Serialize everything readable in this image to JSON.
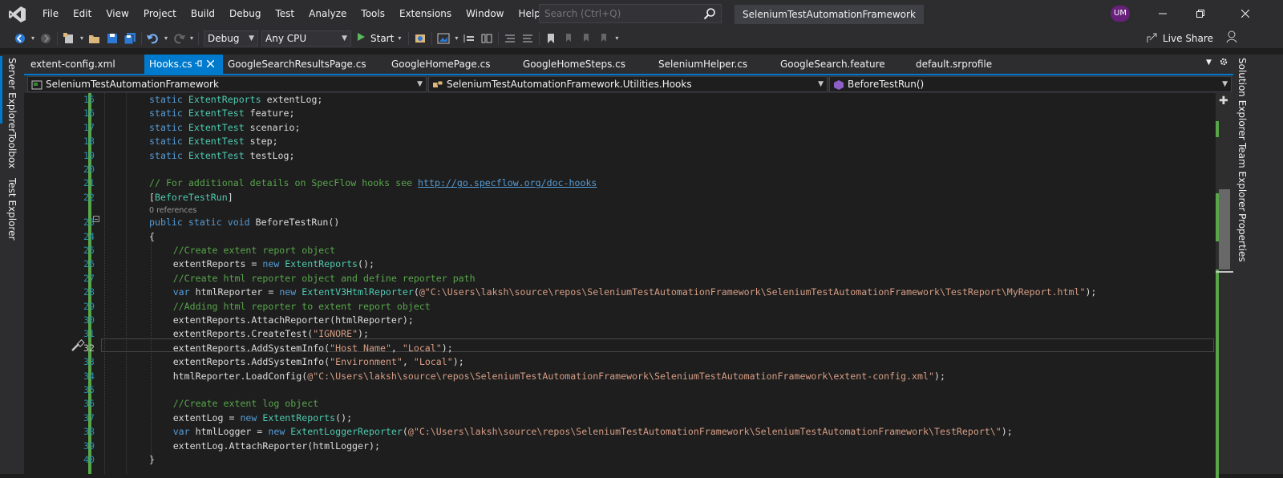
{
  "menu": {
    "items": [
      "File",
      "Edit",
      "View",
      "Project",
      "Build",
      "Debug",
      "Test",
      "Analyze",
      "Tools",
      "Extensions",
      "Window",
      "Help"
    ],
    "search_placeholder": "Search (Ctrl+Q)",
    "solution_title": "SeleniumTestAutomationFramework",
    "avatar": "UM"
  },
  "toolbar": {
    "config": "Debug",
    "platform": "Any CPU",
    "start_label": "Start",
    "live_share": "Live Share"
  },
  "left_dock": [
    "Server Explorer",
    "Toolbox",
    "Test Explorer"
  ],
  "right_dock": [
    "Solution Explorer",
    "Team Explorer",
    "Properties"
  ],
  "tabs": [
    {
      "label": "extent-config.xml"
    },
    {
      "label": "Hooks.cs"
    },
    {
      "label": "GoogleSearchResultsPage.cs"
    },
    {
      "label": "GoogleHomePage.cs"
    },
    {
      "label": "GoogleHomeSteps.cs"
    },
    {
      "label": "SeleniumHelper.cs"
    },
    {
      "label": "GoogleSearch.feature"
    },
    {
      "label": "default.srprofile"
    }
  ],
  "navbar": {
    "project": "SeleniumTestAutomationFramework",
    "type": "SeleniumTestAutomationFramework.Utilities.Hooks",
    "member": "BeforeTestRun()"
  },
  "editor": {
    "references": "0 references",
    "line_numbers": [
      "15",
      "16",
      "17",
      "18",
      "19",
      "20",
      "21",
      "22",
      "23",
      "24",
      "25",
      "26",
      "27",
      "28",
      "29",
      "30",
      "31",
      "32",
      "33",
      "34",
      "35",
      "36",
      "37",
      "38",
      "39",
      "40"
    ],
    "code": {
      "l15": "static ExtentReports extentLog;",
      "l16": "static ExtentTest feature;",
      "l17": "static ExtentTest scenario;",
      "l18": "static ExtentTest step;",
      "l19": "static ExtentTest testLog;",
      "l21_comment": "// For additional details on SpecFlow hooks see ",
      "l21_link": "http://go.specflow.org/doc-hooks",
      "l22": "[BeforeTestRun]",
      "l23": "public static void BeforeTestRun()",
      "l24": "{",
      "l25": "//Create extent report object",
      "l26": "extentReports = new ExtentReports();",
      "l27": "//Create html reporter object and define reporter path",
      "l28_a": "var htmlReporter = new ExtentV3HtmlReporter(",
      "l28_s": "@\"C:\\Users\\laksh\\source\\repos\\SeleniumTestAutomationFramework\\SeleniumTestAutomationFramework\\TestReport\\MyReport.html\"",
      "l28_b": ");",
      "l29": "//Adding html reporter to extent report object",
      "l30": "extentReports.AttachReporter(htmlReporter);",
      "l31_a": "extentReports.CreateTest(",
      "l31_s": "\"IGNORE\"",
      "l31_b": ");",
      "l32_a": "extentReports.AddSystemInfo(",
      "l32_s1": "\"Host Name\"",
      "l32_sep": ", ",
      "l32_s2": "\"Local\"",
      "l32_b": ");",
      "l33_a": "extentReports.AddSystemInfo(",
      "l33_s1": "\"Environment\"",
      "l33_sep": ", ",
      "l33_s2": "\"Local\"",
      "l33_b": ");",
      "l34_a": "htmlReporter.LoadConfig(",
      "l34_s": "@\"C:\\Users\\laksh\\source\\repos\\SeleniumTestAutomationFramework\\SeleniumTestAutomationFramework\\extent-config.xml\"",
      "l34_b": ");",
      "l36": "//Create extent log object",
      "l37": "extentLog = new ExtentReports();",
      "l38_a": "var htmlLogger = new ExtentLoggerReporter(",
      "l38_s": "@\"C:\\Users\\laksh\\source\\repos\\SeleniumTestAutomationFramework\\SeleniumTestAutomationFramework\\TestReport\\\"",
      "l38_b": ");",
      "l39": "extentLog.AttachReporter(htmlLogger);",
      "l40": "}"
    }
  },
  "colors": {
    "accent": "#007acc",
    "keyword": "#569cd6",
    "type": "#4ec9b0",
    "string": "#d69d85",
    "comment": "#57a64a",
    "line_number": "#2b91af"
  },
  "icons": [
    "visual-studio-logo",
    "search-icon",
    "back-icon",
    "forward-icon",
    "new-project-icon",
    "open-folder-icon",
    "save-icon",
    "save-all-icon",
    "undo-icon",
    "redo-icon",
    "start-icon",
    "pin-icon",
    "close-icon",
    "gear-icon",
    "live-share-icon",
    "feedback-icon",
    "screwdriver-icon"
  ]
}
